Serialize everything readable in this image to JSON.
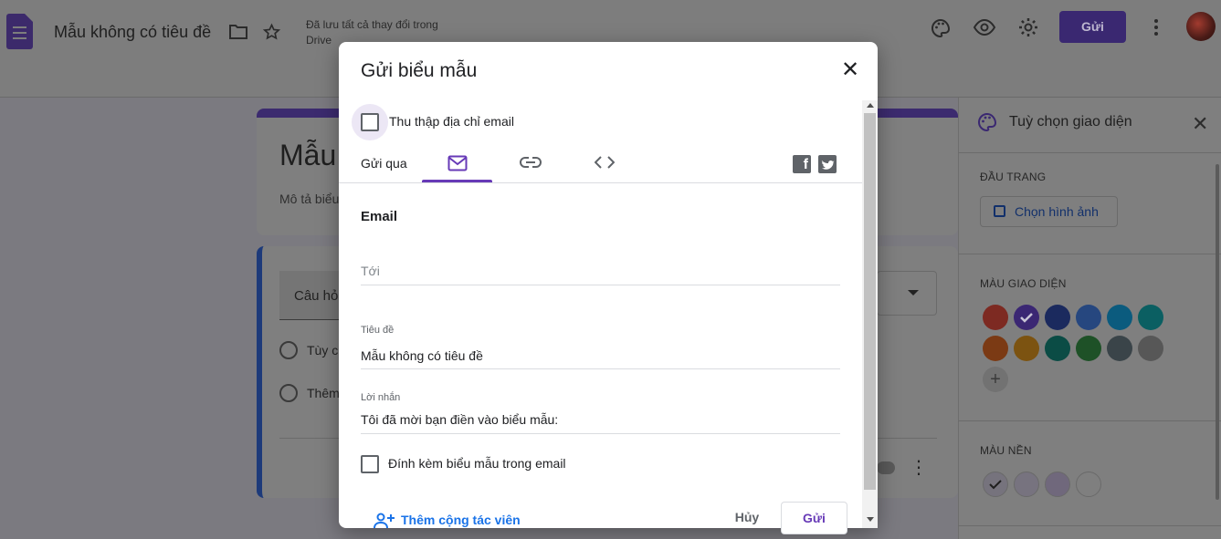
{
  "app": {
    "doc_title": "Mẫu không có tiêu đề",
    "saved_status": "Đã lưu tất cả thay đổi trong Drive",
    "send_button": "Gửi",
    "icons": [
      "forms-doc-icon",
      "folder-icon",
      "star-icon",
      "palette-icon",
      "preview-eye-icon",
      "settings-gear-icon",
      "more-vert-icon",
      "avatar"
    ]
  },
  "background_form": {
    "title": "Mẫu",
    "description": "Mô tả biểu",
    "question_placeholder": "Câu hỏ",
    "options": [
      "Tùy c",
      "Thêm"
    ]
  },
  "side_panel": {
    "title": "Tuỳ chọn giao diện",
    "header_section": "ĐẦU TRANG",
    "choose_image": "Chọn hình ảnh",
    "theme_color_section": "MÀU GIAO DIỆN",
    "theme_colors": [
      "#7d2a22",
      "#3b2773",
      "#1b2a5e",
      "#26477f",
      "#0b5b7e",
      "#0b5f62",
      "#7b3a14",
      "#7c5311",
      "#0b4c45",
      "#1e5127",
      "#3a4449",
      "#575757"
    ],
    "selected_theme_index": 1,
    "background_section": "MÀU NỀN",
    "background_colors": [
      "#76737d",
      "#77737f",
      "#70687c",
      "#7f7f7f"
    ],
    "selected_background_index": 0
  },
  "dialog": {
    "title": "Gửi biểu mẫu",
    "collect_email_label": "Thu thập địa chỉ email",
    "collect_email_checked": false,
    "send_via_label": "Gửi qua",
    "tabs": [
      "email-tab",
      "link-tab",
      "embed-tab"
    ],
    "active_tab": "email-tab",
    "section_heading": "Email",
    "to_placeholder": "Tới",
    "subject_label": "Tiêu đề",
    "subject_value": "Mẫu không có tiêu đề",
    "message_label": "Lời nhắn",
    "message_value": "Tôi đã mời bạn điền vào biểu mẫu:",
    "attach_label": "Đính kèm biểu mẫu trong email",
    "attach_checked": false,
    "add_collaborators": "Thêm cộng tác viên",
    "cancel_button": "Hủy",
    "send_button": "Gửi",
    "accent_color": "#673ab7",
    "link_color": "#1a73e8"
  }
}
